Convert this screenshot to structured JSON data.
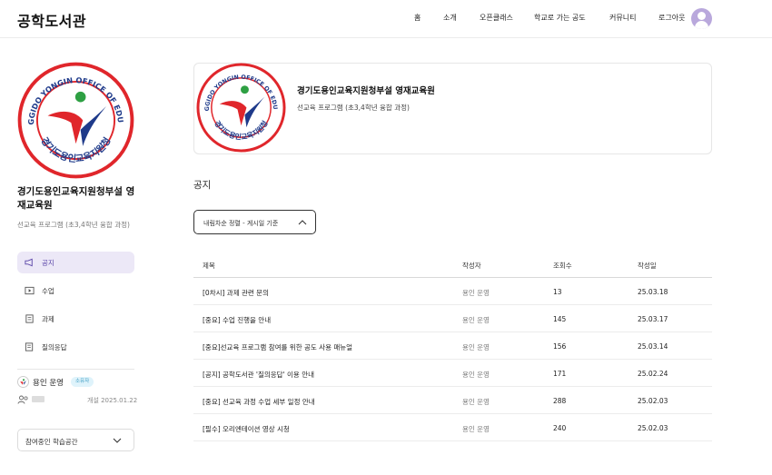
{
  "header": {
    "logo": "공학도서관",
    "nav": [
      "홈",
      "소개",
      "오픈클래스",
      "학교로 가는 공도",
      "커뮤니티",
      "로그아웃"
    ]
  },
  "sidebar": {
    "title": "경기도용인교육지원청부설 영재교육원",
    "subtitle": "선교육 프로그램 (초3,4학년 융합 과정)",
    "menu": [
      {
        "label": "공지",
        "icon": "megaphone-icon",
        "active": true
      },
      {
        "label": "수업",
        "icon": "video-icon",
        "active": false
      },
      {
        "label": "과제",
        "icon": "assignment-icon",
        "active": false
      },
      {
        "label": "질의응답",
        "icon": "qna-icon",
        "active": false
      }
    ],
    "operator": {
      "name": "용인 운영",
      "badge": "소유자"
    },
    "open_date": "개설 2025.01.22",
    "space_select": "참여중인 학습공간"
  },
  "card": {
    "title": "경기도용인교육지원청부설 영재교육원",
    "subtitle": "선교육 프로그램 (초3,4학년 융합 과정)",
    "emblem_text": "GYEONGGIDO YONGIN OFFICE OF EDUCATION",
    "emblem_korean": "경기도용인교육지원청"
  },
  "notices": {
    "section_title": "공지",
    "sort_label": "내림차순 정렬 - 게시일 기준",
    "columns": [
      "제목",
      "작성자",
      "조회수",
      "작성일"
    ],
    "rows": [
      {
        "title": "[0차시] 과제 관련 문의",
        "author": "용인 운영",
        "views": "13",
        "date": "25.03.18"
      },
      {
        "title": "[중요] 수업 진행을 안내",
        "author": "용인 운영",
        "views": "145",
        "date": "25.03.17"
      },
      {
        "title": "[중요]선교육 프로그램 참여를 위한 공도 사용 매뉴얼",
        "author": "용인 운영",
        "views": "156",
        "date": "25.03.14"
      },
      {
        "title": "[공지] 공학도서관 '질의응답' 이용 안내",
        "author": "용인 운영",
        "views": "171",
        "date": "25.02.24"
      },
      {
        "title": "[중요] 선교육 과정 수업 세부 일정 안내",
        "author": "용인 운영",
        "views": "288",
        "date": "25.02.03"
      },
      {
        "title": "[필수] 오리엔테이션 영상 시청",
        "author": "용인 운영",
        "views": "240",
        "date": "25.02.03"
      }
    ]
  },
  "colors": {
    "accent": "#5a45a8",
    "active_bg": "#ece8f7",
    "emblem_red": "#e0262b",
    "emblem_blue": "#1e3a8a",
    "emblem_green": "#2ea043"
  }
}
